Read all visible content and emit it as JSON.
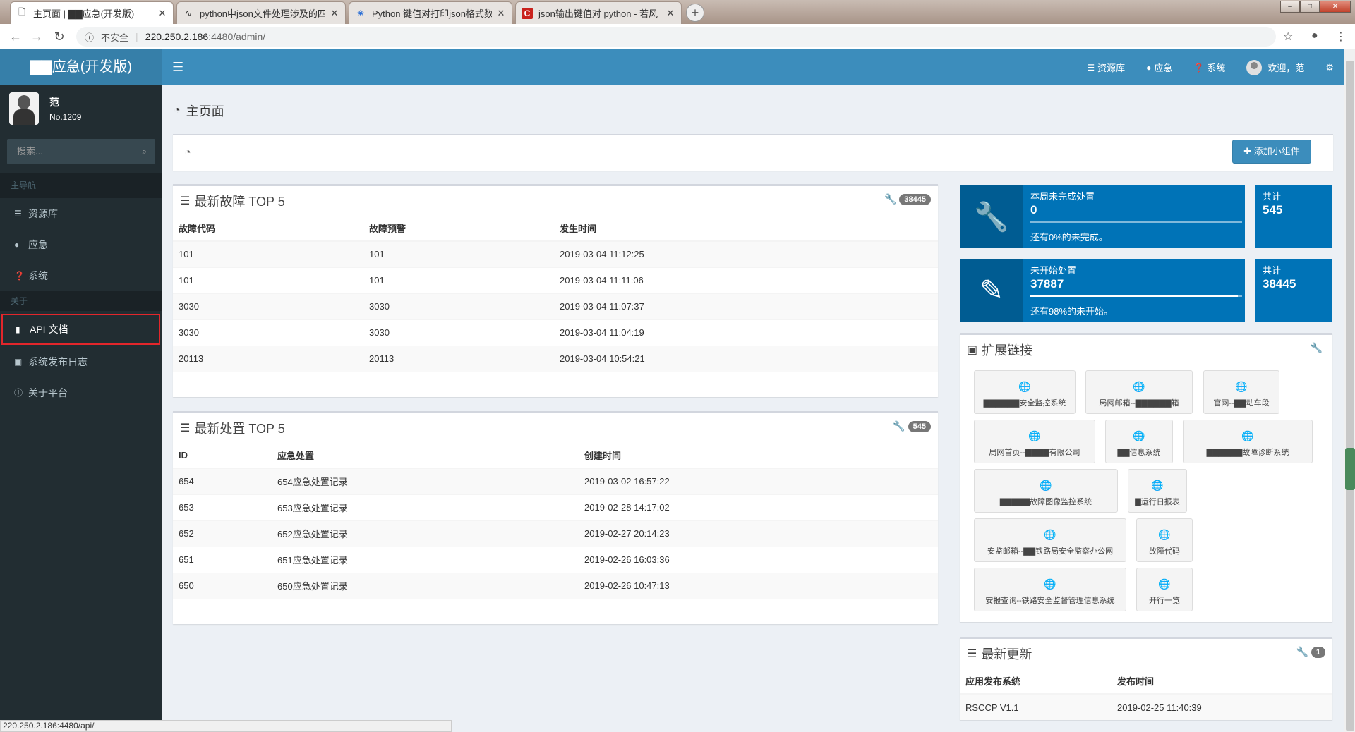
{
  "browser": {
    "tabs": [
      {
        "title": "主页面 | ▇▇应急(开发版)",
        "active": true
      },
      {
        "title": "python中json文件处理涉及的四",
        "active": false
      },
      {
        "title": "Python 键值对打印json格式数据",
        "active": false
      },
      {
        "title": "json输出键值对 python - 若风",
        "active": false
      }
    ],
    "new_tab": "+",
    "security_label": "不安全",
    "url_host": "220.250.2.186",
    "url_rest": ":4480/admin/",
    "status_url": "220.250.2.186:4480/api/"
  },
  "header": {
    "logo": "▇▇应急(开发版)",
    "nav": [
      {
        "icon": "database-icon",
        "label": "资源库"
      },
      {
        "icon": "user-icon",
        "label": "应急"
      },
      {
        "icon": "question-icon",
        "label": "系统"
      }
    ],
    "welcome": "欢迎，范",
    "settings_icon": "cogs-icon"
  },
  "sidebar": {
    "user_name": "范",
    "user_no": "No.1209",
    "search_placeholder": "搜索...",
    "main_header": "主导航",
    "items": [
      {
        "icon": "database-icon",
        "label": "资源库"
      },
      {
        "icon": "user-icon",
        "label": "应急"
      },
      {
        "icon": "question-icon",
        "label": "系统"
      }
    ],
    "about_header": "关于",
    "about_items": [
      {
        "icon": "book-icon",
        "label": "API 文档"
      },
      {
        "icon": "gift-icon",
        "label": "系统发布日志"
      },
      {
        "icon": "info-icon",
        "label": "关于平台"
      }
    ]
  },
  "page": {
    "title": "主页面",
    "add_widget": "添加小组件"
  },
  "faults": {
    "title": "最新故障 TOP 5",
    "badge": "38445",
    "columns": [
      "故障代码",
      "故障预警",
      "发生时间"
    ],
    "rows": [
      [
        "101",
        "101",
        "2019-03-04 11:12:25"
      ],
      [
        "101",
        "101",
        "2019-03-04 11:11:06"
      ],
      [
        "3030",
        "3030",
        "2019-03-04 11:07:37"
      ],
      [
        "3030",
        "3030",
        "2019-03-04 11:04:19"
      ],
      [
        "20113",
        "20113",
        "2019-03-04 10:54:21"
      ]
    ]
  },
  "handling": {
    "title": "最新处置 TOP 5",
    "badge": "545",
    "columns": [
      "ID",
      "应急处置",
      "创建时间"
    ],
    "rows": [
      [
        "654",
        "654应急处置记录",
        "2019-03-02 16:57:22"
      ],
      [
        "653",
        "653应急处置记录",
        "2019-02-28 14:17:02"
      ],
      [
        "652",
        "652应急处置记录",
        "2019-02-27 20:14:23"
      ],
      [
        "651",
        "651应急处置记录",
        "2019-02-26 16:03:36"
      ],
      [
        "650",
        "650应急处置记录",
        "2019-02-26 10:47:13"
      ]
    ]
  },
  "stats": [
    {
      "label": "本周未完成处置",
      "value": "0",
      "progress": 0,
      "desc": "还有0%的未完成。",
      "total_label": "共计",
      "total": "545",
      "icon": "wrench-icon"
    },
    {
      "label": "未开始处置",
      "value": "37887",
      "progress": 0.98,
      "desc": "还有98%的未开始。",
      "total_label": "共计",
      "total": "38445",
      "icon": "pencil-icon"
    }
  ],
  "ext_links": {
    "title": "扩展链接",
    "items": [
      "▇▇▇▇▇▇安全监控系统",
      "局网邮箱--▇▇▇▇▇▇箱",
      "官网--▇▇动车段",
      "局网首页--▇▇▇▇有限公司",
      "▇▇信息系统",
      "▇▇▇▇▇▇故障诊断系统",
      "▇▇▇▇▇故障图像监控系统",
      "▇运行日报表",
      "安监邮箱--▇▇铁路局安全监察办公网",
      "故障代码",
      "安报查询--铁路安全监督管理信息系统",
      "开行一览"
    ]
  },
  "updates": {
    "title": "最新更新",
    "badge": "1",
    "columns": [
      "应用发布系统",
      "发布时间"
    ],
    "rows": [
      [
        "RSCCP V1.1",
        "2019-02-25 11:40:39"
      ]
    ]
  },
  "colors": {
    "header": "#3c8dbc",
    "sidebar": "#222d32",
    "info": "#0073b7",
    "highlight": "#e3262b"
  }
}
